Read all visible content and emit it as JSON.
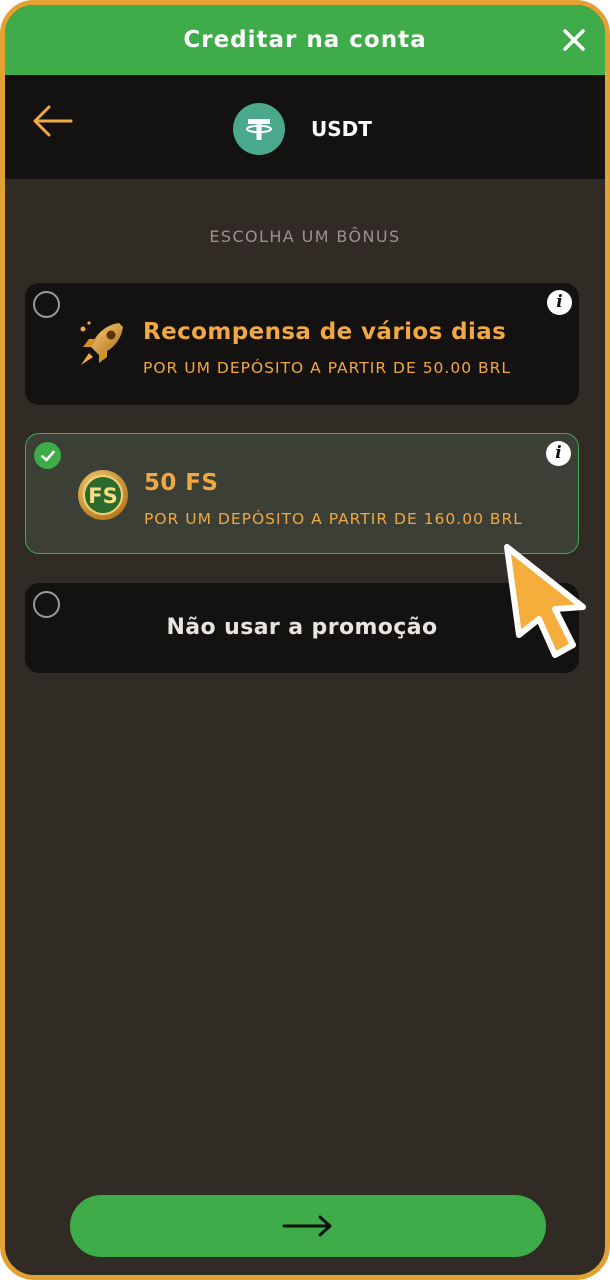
{
  "topbar": {
    "title": "Creditar na conta",
    "close_icon": "close-icon"
  },
  "header": {
    "back_icon": "arrow-left-icon",
    "currency": "USDT",
    "currency_icon": "tether-icon"
  },
  "bonus": {
    "section_label": "ESCOLHA UM BÔNUS",
    "options": [
      {
        "title": "Recompensa de vários dias",
        "subtitle": "POR UM DEPÓSITO A PARTIR DE 50.00 BRL",
        "selected": false,
        "icon": "rocket-icon"
      },
      {
        "title": "50 FS",
        "subtitle": "POR UM DEPÓSITO A PARTIR DE 160.00 BRL",
        "selected": true,
        "icon": "free-spins-coin-icon",
        "icon_text": "FS"
      },
      {
        "title": "Não usar a promoção",
        "selected": false
      }
    ]
  },
  "info_glyph": "i",
  "footer": {
    "next_icon": "arrow-right-icon"
  },
  "colors": {
    "accent_green": "#3eac48",
    "accent_orange": "#f0a842",
    "frame": "#e1a233"
  }
}
